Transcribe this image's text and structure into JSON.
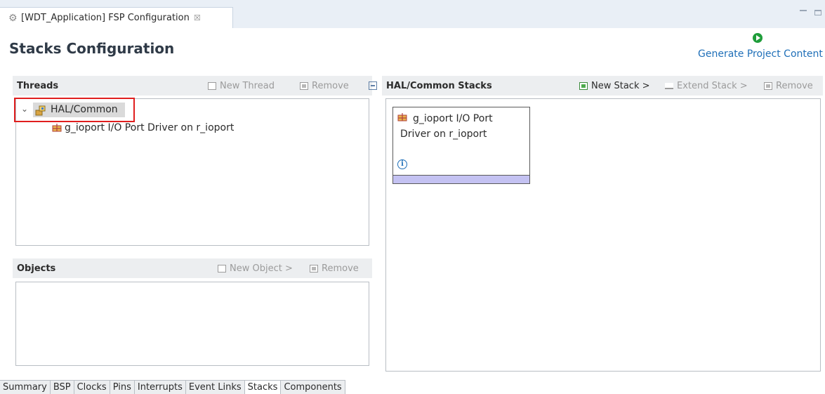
{
  "editor_tab": {
    "title": "[WDT_Application] FSP Configuration",
    "close_glyph": "☒"
  },
  "header": {
    "title": "Stacks Configuration",
    "generate_label": "Generate Project Content"
  },
  "threads": {
    "title": "Threads",
    "new_label": "New Thread",
    "remove_label": "Remove",
    "tree": {
      "root": {
        "label": "HAL/Common",
        "icon": "hal-common-icon",
        "expanded": true
      },
      "children": [
        {
          "label": "g_ioport I/O Port Driver on r_ioport",
          "icon": "module-icon"
        }
      ]
    }
  },
  "objects": {
    "title": "Objects",
    "new_label": "New Object >",
    "remove_label": "Remove"
  },
  "stacks": {
    "title": "HAL/Common Stacks",
    "new_label": "New Stack >",
    "extend_label": "Extend Stack >",
    "remove_label": "Remove",
    "card": {
      "line1": "g_ioport I/O Port",
      "line2": "Driver on r_ioport",
      "info_glyph": "i",
      "bar_color": "#c4c2f2"
    }
  },
  "bottom_tabs": [
    {
      "label": "Summary",
      "active": false
    },
    {
      "label": "BSP",
      "active": false
    },
    {
      "label": "Clocks",
      "active": false
    },
    {
      "label": "Pins",
      "active": false
    },
    {
      "label": "Interrupts",
      "active": false
    },
    {
      "label": "Event Links",
      "active": false
    },
    {
      "label": "Stacks",
      "active": true
    },
    {
      "label": "Components",
      "active": false
    }
  ],
  "colors": {
    "highlight_border": "#e01e1e",
    "link": "#1f6fb8",
    "generate_icon": "#1f9d3a"
  }
}
